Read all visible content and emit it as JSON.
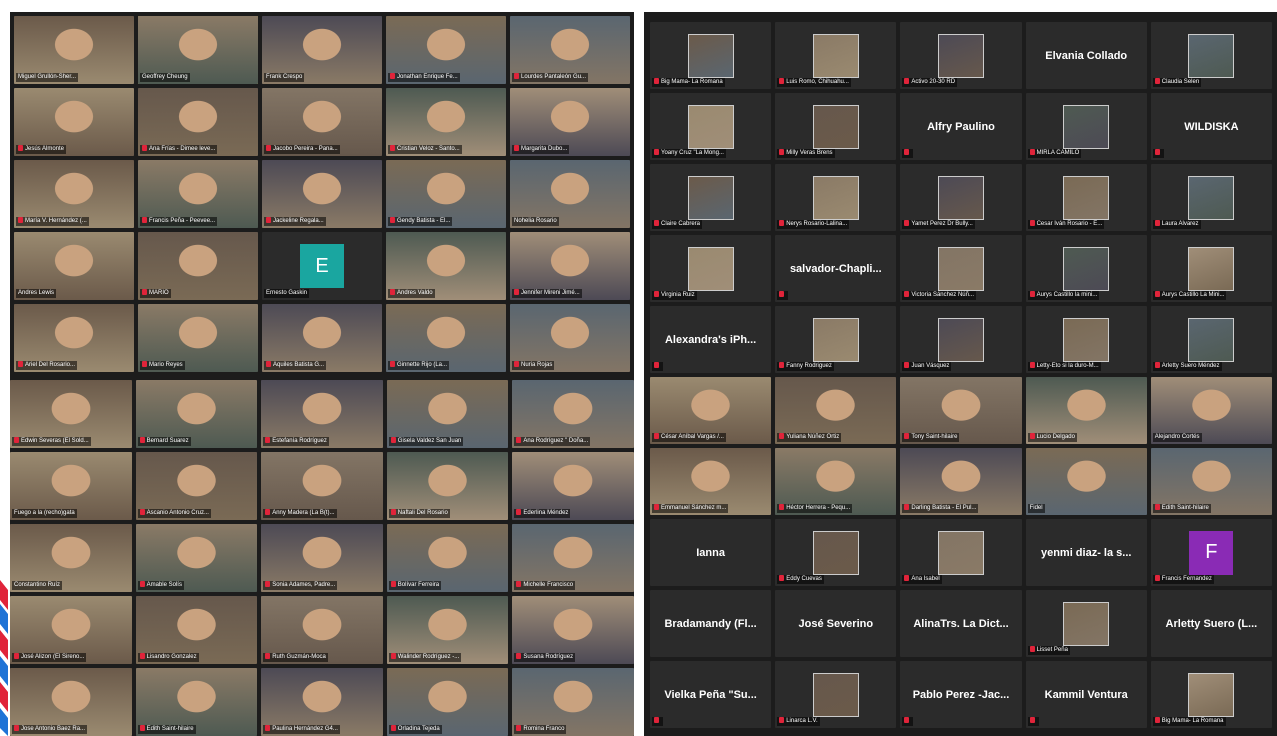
{
  "colors": {
    "mute": "#e0243a",
    "active_speaker_border": "#f6d24a",
    "tile_bg": "#2b2b2b"
  },
  "left_top": [
    {
      "name": "Miguel Grullón-Sher...",
      "muted": false,
      "video": true
    },
    {
      "name": "Geoffrey Cheung",
      "muted": false,
      "video": true,
      "speaker": true
    },
    {
      "name": "Frank Crespo",
      "muted": false,
      "video": true
    },
    {
      "name": "Jonathan Enrique Fe...",
      "muted": true,
      "video": true
    },
    {
      "name": "Lourdes Pantaleón Gu...",
      "muted": true,
      "video": true
    },
    {
      "name": "Jesús Almonte",
      "muted": true,
      "video": true
    },
    {
      "name": "Ana Frías - Dimee leve...",
      "muted": true,
      "video": true
    },
    {
      "name": "Jacobo Pereira - Pana...",
      "muted": true,
      "video": true
    },
    {
      "name": "Cristian Veloz - Santo...",
      "muted": true,
      "video": true
    },
    {
      "name": "Margarita Dubo...",
      "muted": true,
      "video": true
    },
    {
      "name": "María V. Hernández (...",
      "muted": true,
      "video": true
    },
    {
      "name": "Francis Peña - Peevee...",
      "muted": true,
      "video": true
    },
    {
      "name": "Jackeline Regala...",
      "muted": true,
      "video": true
    },
    {
      "name": "Gendy Batista - El...",
      "muted": true,
      "video": true
    },
    {
      "name": "Nohelia Rosario",
      "muted": false,
      "video": true
    },
    {
      "name": "Andres Lewis",
      "muted": false,
      "video": true
    },
    {
      "name": "MARIO",
      "muted": true,
      "video": true
    },
    {
      "name": "Ernesto Gaskin",
      "muted": false,
      "video": false,
      "letter": "E",
      "avatar_color": "#1aa6a0"
    },
    {
      "name": "Andres Valdo",
      "muted": true,
      "video": true
    },
    {
      "name": "Jennifer Mireni Jimé...",
      "muted": true,
      "video": true
    },
    {
      "name": "Ariel Del Rosario...",
      "muted": true,
      "video": true
    },
    {
      "name": "Mario Reyes",
      "muted": true,
      "video": true
    },
    {
      "name": "Aquiles Batista G...",
      "muted": true,
      "video": true
    },
    {
      "name": "Ginnette Rijo (La...",
      "muted": true,
      "video": true
    },
    {
      "name": "Nuria Rojas",
      "muted": true,
      "video": true
    }
  ],
  "left_bottom": [
    {
      "name": "Edwin Severas (El Sold...",
      "muted": true,
      "video": true
    },
    {
      "name": "Bernard Suarez",
      "muted": true,
      "video": true
    },
    {
      "name": "Estefanía Rodríguez",
      "muted": true,
      "video": true
    },
    {
      "name": "Gisela Valdez San Juan",
      "muted": true,
      "video": true
    },
    {
      "name": "Ana Rodríguez \" Doña...",
      "muted": true,
      "video": true
    },
    {
      "name": "Fuego a la (recho)gata",
      "muted": false,
      "video": true
    },
    {
      "name": "Ascanio Antonio Cruz...",
      "muted": true,
      "video": true
    },
    {
      "name": "Anny Madera (La B(t)...",
      "muted": true,
      "video": true
    },
    {
      "name": "Naftali Del Rosario",
      "muted": true,
      "video": true
    },
    {
      "name": "Ederlina Méndez",
      "muted": true,
      "video": true
    },
    {
      "name": "Constantino Ruíz",
      "muted": false,
      "video": true
    },
    {
      "name": "Amable Solís",
      "muted": true,
      "video": true
    },
    {
      "name": "Sonia Adames, Padre...",
      "muted": true,
      "video": true
    },
    {
      "name": "Bolívar Ferreira",
      "muted": true,
      "video": true
    },
    {
      "name": "Michelle Francisco",
      "muted": true,
      "video": true
    },
    {
      "name": "José Alizon (El Sireno...",
      "muted": true,
      "video": true
    },
    {
      "name": "Lisandro Gonzalez",
      "muted": true,
      "video": true
    },
    {
      "name": "Ruth Guzmán-Moca",
      "muted": true,
      "video": true
    },
    {
      "name": "Walinder Rodríguez -...",
      "muted": true,
      "video": true
    },
    {
      "name": "Susana Rodríguez",
      "muted": true,
      "video": true
    },
    {
      "name": "Jose Antonio Baez Ra...",
      "muted": true,
      "video": true
    },
    {
      "name": "Edith Saint-hilaire",
      "muted": true,
      "video": true
    },
    {
      "name": "Paulina Hernández G4...",
      "muted": true,
      "video": true
    },
    {
      "name": "Orladina Tejeda",
      "muted": true,
      "video": true
    },
    {
      "name": "Romina Franco",
      "muted": true,
      "video": true
    }
  ],
  "right_grid": [
    {
      "name": "Big Mama- La Romana",
      "muted": true,
      "kind": "thumb"
    },
    {
      "name": "Luis Romo, Chihuahu...",
      "muted": true,
      "kind": "thumb"
    },
    {
      "name": "Activo 20-30 RD",
      "muted": true,
      "kind": "thumb"
    },
    {
      "name": "",
      "muted": false,
      "kind": "text",
      "display": "Elvania Collado"
    },
    {
      "name": "Claudia Selen",
      "muted": true,
      "kind": "thumb"
    },
    {
      "name": "Yoany Cruz \"La Mong...",
      "muted": true,
      "kind": "thumb"
    },
    {
      "name": "Milly Veras Brens",
      "muted": true,
      "kind": "thumb"
    },
    {
      "name": "",
      "muted": true,
      "kind": "text",
      "display": "Alfry Paulino"
    },
    {
      "name": "MIRLA CAMILO",
      "muted": true,
      "kind": "thumb"
    },
    {
      "name": "",
      "muted": true,
      "kind": "text",
      "display": "WILDISKA"
    },
    {
      "name": "Claire Cabrera",
      "muted": true,
      "kind": "thumb"
    },
    {
      "name": "Nerys Rosario-Lalina...",
      "muted": true,
      "kind": "thumb"
    },
    {
      "name": "Yamet Perez Dr Bully...",
      "muted": true,
      "kind": "thumb"
    },
    {
      "name": "Cesar Iván Rosario - E...",
      "muted": true,
      "kind": "thumb"
    },
    {
      "name": "Laura Alvarez",
      "muted": true,
      "kind": "thumb"
    },
    {
      "name": "Virginia Ruiz",
      "muted": true,
      "kind": "thumb"
    },
    {
      "name": "",
      "muted": true,
      "kind": "text",
      "display": "salvador-Chapli..."
    },
    {
      "name": "Victoria Sánchez Núñ...",
      "muted": true,
      "kind": "thumb"
    },
    {
      "name": "Aurys Castillo la mini...",
      "muted": true,
      "kind": "thumb"
    },
    {
      "name": "Aurys Castillo La Mini...",
      "muted": true,
      "kind": "thumb"
    },
    {
      "name": "",
      "muted": true,
      "kind": "text",
      "display": "Alexandra's iPh..."
    },
    {
      "name": "Fanny Rodriguez",
      "muted": true,
      "kind": "thumb"
    },
    {
      "name": "Juan Vásquez",
      "muted": true,
      "kind": "thumb"
    },
    {
      "name": "Letty-Eto si la duro-M...",
      "muted": true,
      "kind": "thumb"
    },
    {
      "name": "Arletty Suero Méndez",
      "muted": true,
      "kind": "thumb"
    },
    {
      "name": "César Aníbal Vargas /...",
      "muted": true,
      "kind": "video"
    },
    {
      "name": "Yuliana Núñez Ortiz",
      "muted": true,
      "kind": "video"
    },
    {
      "name": "Tony Saint-hilaire",
      "muted": true,
      "kind": "video"
    },
    {
      "name": "Lucio Delgado",
      "muted": true,
      "kind": "video"
    },
    {
      "name": "Alejandro Cortés",
      "muted": false,
      "kind": "video"
    },
    {
      "name": "Emmanuel Sánchez m...",
      "muted": true,
      "kind": "video"
    },
    {
      "name": "Héctor Herrera - Pequ...",
      "muted": true,
      "kind": "video"
    },
    {
      "name": "Darling Batista - El Pul...",
      "muted": true,
      "kind": "video"
    },
    {
      "name": "Fidel",
      "muted": false,
      "kind": "video"
    },
    {
      "name": "Edith Saint-hilaire",
      "muted": true,
      "kind": "video"
    },
    {
      "name": "",
      "muted": false,
      "kind": "text",
      "display": "Ianna"
    },
    {
      "name": "Eddy Cuevas",
      "muted": true,
      "kind": "thumb"
    },
    {
      "name": "Ana Isabel",
      "muted": true,
      "kind": "thumb"
    },
    {
      "name": "",
      "muted": false,
      "kind": "text",
      "display": "yenmi diaz- la s..."
    },
    {
      "name": "Francis Fernandez",
      "muted": true,
      "kind": "letter",
      "letter": "F",
      "avatar_color": "#8a2bb5"
    },
    {
      "name": "",
      "muted": false,
      "kind": "text",
      "display": "Bradamandy (Fl..."
    },
    {
      "name": "",
      "muted": false,
      "kind": "text",
      "display": "José Severino"
    },
    {
      "name": "",
      "muted": false,
      "kind": "text",
      "display": "AlinaTrs. La Dict..."
    },
    {
      "name": "Lisset Peña",
      "muted": true,
      "kind": "thumb"
    },
    {
      "name": "",
      "muted": false,
      "kind": "text",
      "display": "Arletty Suero (L..."
    },
    {
      "name": "",
      "muted": true,
      "kind": "text",
      "display": "Vielka Peña \"Su..."
    },
    {
      "name": "Linarca L.V.",
      "muted": true,
      "kind": "thumb"
    },
    {
      "name": "",
      "muted": true,
      "kind": "text",
      "display": "Pablo Perez -Jac..."
    },
    {
      "name": "",
      "muted": true,
      "kind": "text",
      "display": "Kammil Ventura"
    },
    {
      "name": "Big Mama- La Romana",
      "muted": true,
      "kind": "thumb"
    }
  ]
}
